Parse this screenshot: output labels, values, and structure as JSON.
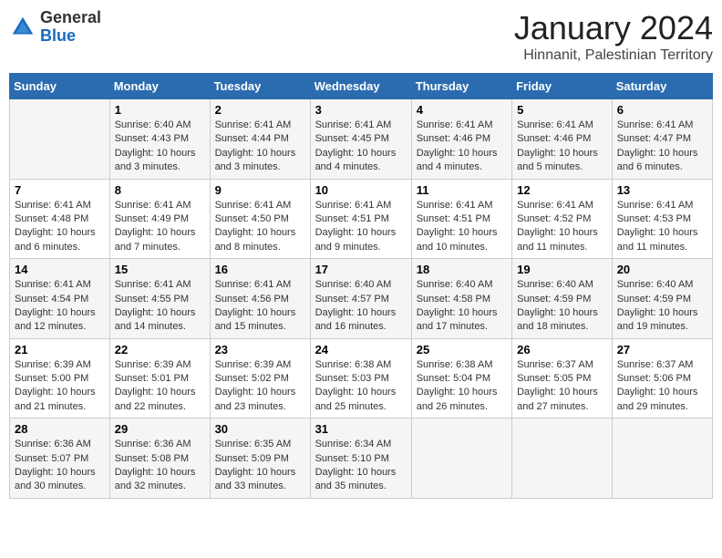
{
  "header": {
    "logo": {
      "general": "General",
      "blue": "Blue"
    },
    "title": "January 2024",
    "subtitle": "Hinnanit, Palestinian Territory"
  },
  "calendar": {
    "days_of_week": [
      "Sunday",
      "Monday",
      "Tuesday",
      "Wednesday",
      "Thursday",
      "Friday",
      "Saturday"
    ],
    "weeks": [
      [
        {
          "num": "",
          "sunrise": "",
          "sunset": "",
          "daylight": ""
        },
        {
          "num": "1",
          "sunrise": "Sunrise: 6:40 AM",
          "sunset": "Sunset: 4:43 PM",
          "daylight": "Daylight: 10 hours and 3 minutes."
        },
        {
          "num": "2",
          "sunrise": "Sunrise: 6:41 AM",
          "sunset": "Sunset: 4:44 PM",
          "daylight": "Daylight: 10 hours and 3 minutes."
        },
        {
          "num": "3",
          "sunrise": "Sunrise: 6:41 AM",
          "sunset": "Sunset: 4:45 PM",
          "daylight": "Daylight: 10 hours and 4 minutes."
        },
        {
          "num": "4",
          "sunrise": "Sunrise: 6:41 AM",
          "sunset": "Sunset: 4:46 PM",
          "daylight": "Daylight: 10 hours and 4 minutes."
        },
        {
          "num": "5",
          "sunrise": "Sunrise: 6:41 AM",
          "sunset": "Sunset: 4:46 PM",
          "daylight": "Daylight: 10 hours and 5 minutes."
        },
        {
          "num": "6",
          "sunrise": "Sunrise: 6:41 AM",
          "sunset": "Sunset: 4:47 PM",
          "daylight": "Daylight: 10 hours and 6 minutes."
        }
      ],
      [
        {
          "num": "7",
          "sunrise": "Sunrise: 6:41 AM",
          "sunset": "Sunset: 4:48 PM",
          "daylight": "Daylight: 10 hours and 6 minutes."
        },
        {
          "num": "8",
          "sunrise": "Sunrise: 6:41 AM",
          "sunset": "Sunset: 4:49 PM",
          "daylight": "Daylight: 10 hours and 7 minutes."
        },
        {
          "num": "9",
          "sunrise": "Sunrise: 6:41 AM",
          "sunset": "Sunset: 4:50 PM",
          "daylight": "Daylight: 10 hours and 8 minutes."
        },
        {
          "num": "10",
          "sunrise": "Sunrise: 6:41 AM",
          "sunset": "Sunset: 4:51 PM",
          "daylight": "Daylight: 10 hours and 9 minutes."
        },
        {
          "num": "11",
          "sunrise": "Sunrise: 6:41 AM",
          "sunset": "Sunset: 4:51 PM",
          "daylight": "Daylight: 10 hours and 10 minutes."
        },
        {
          "num": "12",
          "sunrise": "Sunrise: 6:41 AM",
          "sunset": "Sunset: 4:52 PM",
          "daylight": "Daylight: 10 hours and 11 minutes."
        },
        {
          "num": "13",
          "sunrise": "Sunrise: 6:41 AM",
          "sunset": "Sunset: 4:53 PM",
          "daylight": "Daylight: 10 hours and 11 minutes."
        }
      ],
      [
        {
          "num": "14",
          "sunrise": "Sunrise: 6:41 AM",
          "sunset": "Sunset: 4:54 PM",
          "daylight": "Daylight: 10 hours and 12 minutes."
        },
        {
          "num": "15",
          "sunrise": "Sunrise: 6:41 AM",
          "sunset": "Sunset: 4:55 PM",
          "daylight": "Daylight: 10 hours and 14 minutes."
        },
        {
          "num": "16",
          "sunrise": "Sunrise: 6:41 AM",
          "sunset": "Sunset: 4:56 PM",
          "daylight": "Daylight: 10 hours and 15 minutes."
        },
        {
          "num": "17",
          "sunrise": "Sunrise: 6:40 AM",
          "sunset": "Sunset: 4:57 PM",
          "daylight": "Daylight: 10 hours and 16 minutes."
        },
        {
          "num": "18",
          "sunrise": "Sunrise: 6:40 AM",
          "sunset": "Sunset: 4:58 PM",
          "daylight": "Daylight: 10 hours and 17 minutes."
        },
        {
          "num": "19",
          "sunrise": "Sunrise: 6:40 AM",
          "sunset": "Sunset: 4:59 PM",
          "daylight": "Daylight: 10 hours and 18 minutes."
        },
        {
          "num": "20",
          "sunrise": "Sunrise: 6:40 AM",
          "sunset": "Sunset: 4:59 PM",
          "daylight": "Daylight: 10 hours and 19 minutes."
        }
      ],
      [
        {
          "num": "21",
          "sunrise": "Sunrise: 6:39 AM",
          "sunset": "Sunset: 5:00 PM",
          "daylight": "Daylight: 10 hours and 21 minutes."
        },
        {
          "num": "22",
          "sunrise": "Sunrise: 6:39 AM",
          "sunset": "Sunset: 5:01 PM",
          "daylight": "Daylight: 10 hours and 22 minutes."
        },
        {
          "num": "23",
          "sunrise": "Sunrise: 6:39 AM",
          "sunset": "Sunset: 5:02 PM",
          "daylight": "Daylight: 10 hours and 23 minutes."
        },
        {
          "num": "24",
          "sunrise": "Sunrise: 6:38 AM",
          "sunset": "Sunset: 5:03 PM",
          "daylight": "Daylight: 10 hours and 25 minutes."
        },
        {
          "num": "25",
          "sunrise": "Sunrise: 6:38 AM",
          "sunset": "Sunset: 5:04 PM",
          "daylight": "Daylight: 10 hours and 26 minutes."
        },
        {
          "num": "26",
          "sunrise": "Sunrise: 6:37 AM",
          "sunset": "Sunset: 5:05 PM",
          "daylight": "Daylight: 10 hours and 27 minutes."
        },
        {
          "num": "27",
          "sunrise": "Sunrise: 6:37 AM",
          "sunset": "Sunset: 5:06 PM",
          "daylight": "Daylight: 10 hours and 29 minutes."
        }
      ],
      [
        {
          "num": "28",
          "sunrise": "Sunrise: 6:36 AM",
          "sunset": "Sunset: 5:07 PM",
          "daylight": "Daylight: 10 hours and 30 minutes."
        },
        {
          "num": "29",
          "sunrise": "Sunrise: 6:36 AM",
          "sunset": "Sunset: 5:08 PM",
          "daylight": "Daylight: 10 hours and 32 minutes."
        },
        {
          "num": "30",
          "sunrise": "Sunrise: 6:35 AM",
          "sunset": "Sunset: 5:09 PM",
          "daylight": "Daylight: 10 hours and 33 minutes."
        },
        {
          "num": "31",
          "sunrise": "Sunrise: 6:34 AM",
          "sunset": "Sunset: 5:10 PM",
          "daylight": "Daylight: 10 hours and 35 minutes."
        },
        {
          "num": "",
          "sunrise": "",
          "sunset": "",
          "daylight": ""
        },
        {
          "num": "",
          "sunrise": "",
          "sunset": "",
          "daylight": ""
        },
        {
          "num": "",
          "sunrise": "",
          "sunset": "",
          "daylight": ""
        }
      ]
    ]
  }
}
